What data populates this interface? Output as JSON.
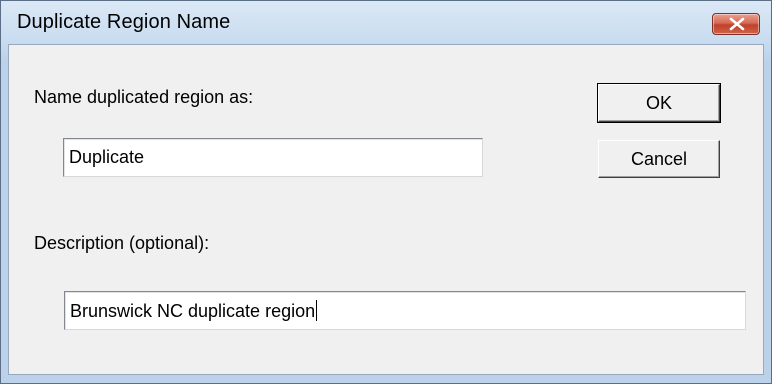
{
  "window": {
    "title": "Duplicate Region Name",
    "close_icon": "close-icon"
  },
  "form": {
    "name_label": "Name duplicated region as:",
    "name_value": "Duplicate",
    "description_label": "Description (optional):",
    "description_value": "Brunswick NC duplicate region"
  },
  "buttons": {
    "ok_label": "OK",
    "cancel_label": "Cancel"
  },
  "colors": {
    "client_bg": "#f0f0f0",
    "close_button": "#c7432d"
  }
}
